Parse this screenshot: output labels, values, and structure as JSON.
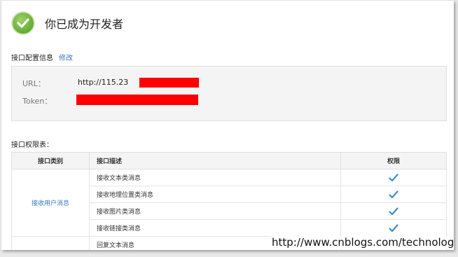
{
  "header": {
    "title": "你已成为开发者",
    "icon": "check-circle-icon"
  },
  "config": {
    "section_title": "接口配置信息",
    "edit_link": "修改",
    "url_label": "URL：",
    "url_value": "http://115.23",
    "token_label": "Token："
  },
  "permissions": {
    "section_title": "接口权限表：",
    "columns": [
      "接口类别",
      "接口描述",
      "权限"
    ],
    "group_label": "接收用户消息",
    "rows": [
      {
        "desc": "接收文本类消息",
        "granted": true
      },
      {
        "desc": "接收地理位置类消息",
        "granted": true
      },
      {
        "desc": "接收图片类消息",
        "granted": true
      },
      {
        "desc": "接收链接类消息",
        "granted": true
      },
      {
        "desc": "回复文本消息",
        "granted": false
      }
    ]
  },
  "watermark": "http://www.cnblogs.com/technology/",
  "colors": {
    "link": "#3a78c0",
    "check": "#3b8fc6",
    "success_green": "#6fb43b",
    "redaction": "#ff0000"
  }
}
